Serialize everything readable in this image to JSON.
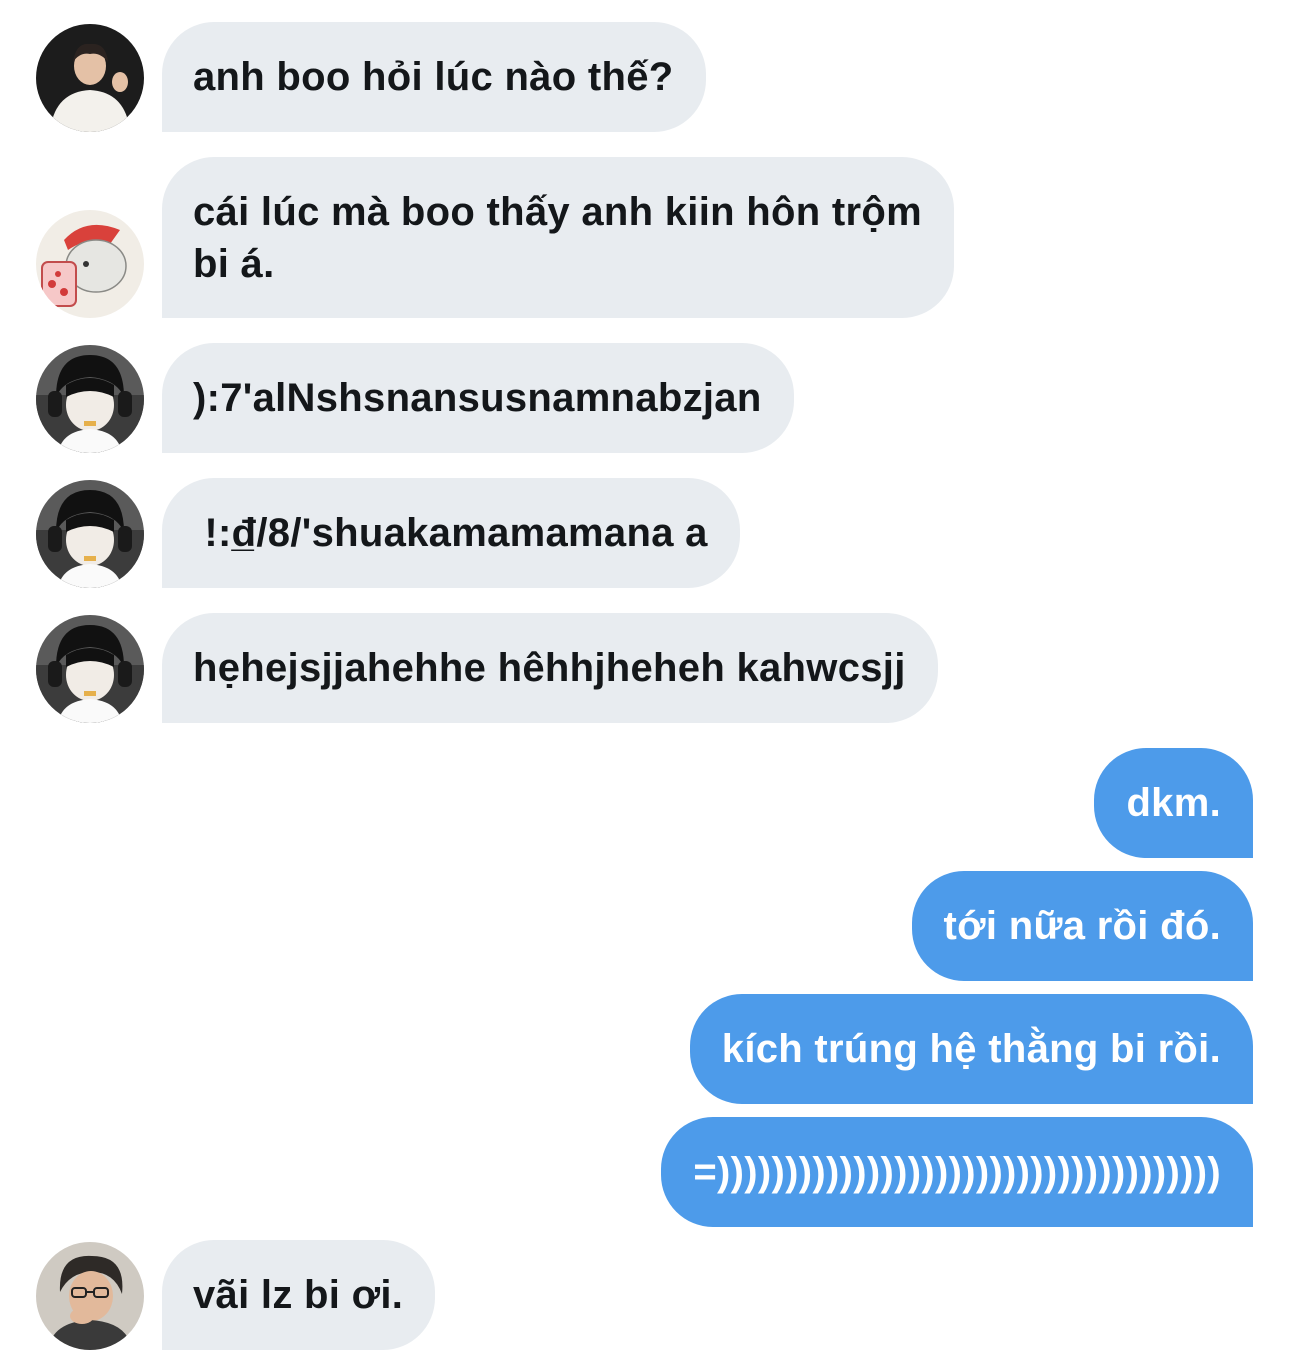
{
  "conversation": {
    "messages": [
      {
        "text": "anh boo hỏi lúc nào thế?",
        "avatar": "avatar-young-man-white-shirt"
      },
      {
        "text": "cái lúc mà boo thấy anh kiin hôn trộm\nbi á.",
        "avatar": "avatar-cartoon-bear-strawberry"
      },
      {
        "text": "):7'alNshsnansusnamnabzjan",
        "avatar": "avatar-boy-headphones"
      },
      {
        "text": " !:đ̲/8/'shuakamamamana a",
        "avatar": "avatar-boy-headphones"
      },
      {
        "text": "hẹhejsjjahehhe hêhhjheheh kahwcsjj",
        "avatar": "avatar-boy-headphones"
      },
      {
        "text": "dkm."
      },
      {
        "text": "tới nữa rồi đó."
      },
      {
        "text": "kích trúng hệ thằng bi rồi."
      },
      {
        "text": "=)))))))))))))))))))))))))))))))))))))"
      },
      {
        "text": "vãi lz bi ơi.",
        "avatar": "avatar-man-glasses"
      }
    ]
  },
  "colors": {
    "incoming_bubble": "#e8ecf0",
    "outgoing_bubble": "#4d9bea",
    "incoming_text": "#14171a",
    "outgoing_text": "#ffffff"
  }
}
